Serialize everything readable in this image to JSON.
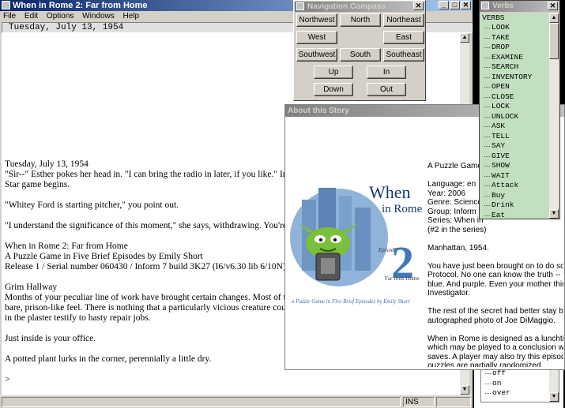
{
  "main_window": {
    "title": "When in Rome 2: Far from Home",
    "menu": [
      "File",
      "Edit",
      "Options",
      "Windows",
      "Help"
    ],
    "status_line": "Tuesday, July 13, 1954",
    "ins_label": "INS"
  },
  "story": {
    "lines": [
      "Tuesday, July 13, 1954",
      "\"Sir--\" Esther pokes her head in. \"I can bring the radio in later, if you like.\" In case yo",
      "Star game begins.",
      "",
      "\"Whitey Ford is starting pitcher,\" you point out.",
      "",
      "\"I understand the significance of this moment,\" she says, withdrawing. You're making",
      "",
      "When in Rome 2: Far from Home",
      "A Puzzle Game in Five Brief Episodes by Emily Short",
      "Release 1 / Serial number 060430 / Inform 7 build 3K27 (I6/v6.30 lib 6/10N)",
      "",
      "Grim Hallway",
      "Months of your peculiar line of work have brought certain changes. Most of the deco",
      "bare, prison-like feel. There is nothing that a particularly vicious creature could take,",
      "in the plaster testify to hasty repair jobs.",
      "",
      "Just inside is your office.",
      "",
      "A potted plant lurks in the corner, perennially a little dry.",
      "",
      ">"
    ]
  },
  "compass": {
    "title": "Navigation Compass",
    "buttons": {
      "northwest": "Northwest",
      "north": "North",
      "northeast": "Northeast",
      "west": "West",
      "east": "East",
      "southwest": "Southwest",
      "south": "South",
      "southeast": "Southeast",
      "up": "Up",
      "in": "In",
      "down": "Down",
      "out": "Out"
    }
  },
  "verbs": {
    "title": "Verbs",
    "root": "VERBS",
    "items": [
      "LOOK",
      "TAKE",
      "DROP",
      "EXAMINE",
      "SEARCH",
      "INVENTORY",
      "OPEN",
      "CLOSE",
      "LOCK",
      "UNLOCK",
      "ASK",
      "TELL",
      "SAY",
      "GIVE",
      "SHOW",
      "WAIT",
      "Attack",
      "Buy",
      "Drink",
      "Eat"
    ]
  },
  "objects": {
    "items": [
      "off",
      "on",
      "over"
    ]
  },
  "about": {
    "title": "About this Story",
    "cover": {
      "title_line1": "When",
      "title_line2": "in Rome",
      "episode_label": "Episode",
      "episode_number": "2",
      "subtitle": "Far from Home",
      "caption": "a Puzzle Game in Five Brief Episodes by Emily Short"
    },
    "lines": [
      "A Puzzle Game",
      "",
      "Language: en",
      "Year: 2006",
      "Genre: Science",
      "Group: Inform",
      "Series: When in",
      "(#2 in the series)",
      "",
      "Manhattan, 1954.",
      "",
      "You have just been brought on to do some",
      "Protocol. No one can know the truth -- that th",
      "blue. And purple. Even your mother thinks y",
      "Investigator.",
      "",
      "The rest of the secret had better stay betwe",
      "autographed photo of Joe DiMaggio.",
      "",
      "When in Rome is designed as a lunchtime",
      "which may be played to a conclusion within",
      "saves. A player may also try this episode",
      "puzzles are partially randomized."
    ]
  },
  "colors": {
    "titlebar_active": "#0a246a",
    "titlebar_inactive": "#808080",
    "verbs_background": "#c2e0c0",
    "chrome": "#d4d0c8"
  }
}
